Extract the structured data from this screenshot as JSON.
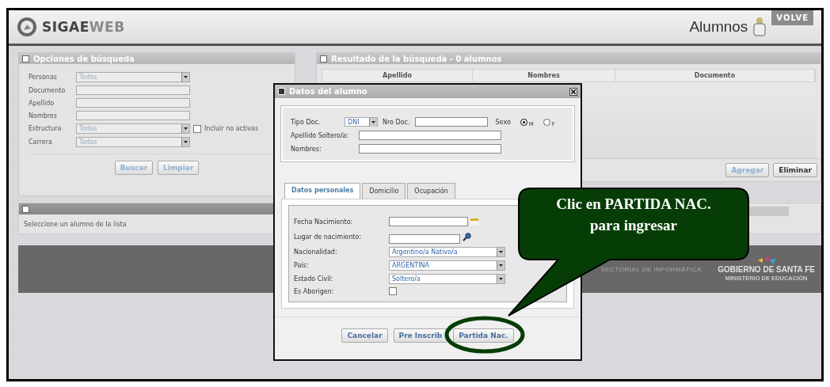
{
  "header": {
    "app_name_strong": "SIGAE",
    "app_name_light": "WEB",
    "section": "Alumnos",
    "back_button": "VOLVE"
  },
  "search_panel": {
    "title": "Opciones de búsqueda",
    "fields": [
      {
        "kind": "select",
        "label": "Personas",
        "value": "Todos"
      },
      {
        "kind": "text",
        "label": "Documento"
      },
      {
        "kind": "text",
        "label": "Apellido"
      },
      {
        "kind": "text",
        "label": "Nombres"
      },
      {
        "kind": "select",
        "label": "Estructura",
        "value": "Todas",
        "checkbox": {
          "label": "Incluir no activas",
          "checked": false
        }
      },
      {
        "kind": "select",
        "label": "Carrera",
        "value": "Todas"
      }
    ],
    "buttons": [
      {
        "label": "Buscar",
        "disabled": true
      },
      {
        "label": "Limpiar",
        "disabled": true
      }
    ]
  },
  "detail_panel": {
    "message": "Seleccione un alumno de la lista"
  },
  "results_panel": {
    "title": "Resultado de la búsqueda - 0 alumnos",
    "columns": [
      "Apellido",
      "Nombres",
      "Documento"
    ],
    "buttons": [
      {
        "label": "Agregar",
        "disabled": true
      },
      {
        "label": "Eliminar",
        "disabled": false
      }
    ]
  },
  "footer": {
    "sectorial": "SECTORIAL DE INFORMÁTICA",
    "government": "GOBIERNO DE SANTA FE",
    "ministry": "MINISTERIO DE EDUCACIÓN"
  },
  "dialog": {
    "title": "Datos del alumno",
    "doc_type_label": "Tipo Doc.",
    "doc_type": "DNI",
    "doc_number_label": "Nro Doc.",
    "sex_label": "Sexo",
    "sex_options": [
      {
        "label": "M",
        "selected": true
      },
      {
        "label": "F",
        "selected": false
      }
    ],
    "surname_label": "Apellido Soltero/a:",
    "names_label": "Nombres:",
    "tabs": [
      {
        "label": "Datos personales",
        "selected": true
      },
      {
        "label": "Domicilio",
        "selected": false
      },
      {
        "label": "Ocupación",
        "selected": false
      }
    ],
    "fields": [
      {
        "kind": "date",
        "label": "Fecha Nacimiento:"
      },
      {
        "kind": "lookup",
        "label": "Lugar de nacimiento:"
      },
      {
        "kind": "select",
        "label": "Nacionalidad:",
        "value": "Argentino/a Nativo/a"
      },
      {
        "kind": "select",
        "label": "País:",
        "value": "ARGENTINA"
      },
      {
        "kind": "select",
        "label": "Estado Civil:",
        "value": "Soltero/a"
      },
      {
        "kind": "checkbox",
        "label": "Es Aborigen:",
        "checked": false
      }
    ],
    "buttons": [
      "Cancelar",
      "Pre Inscrib",
      "Partida Nac."
    ]
  },
  "callout": {
    "text": "Clic en PARTIDA NAC.\npara ingresar"
  }
}
